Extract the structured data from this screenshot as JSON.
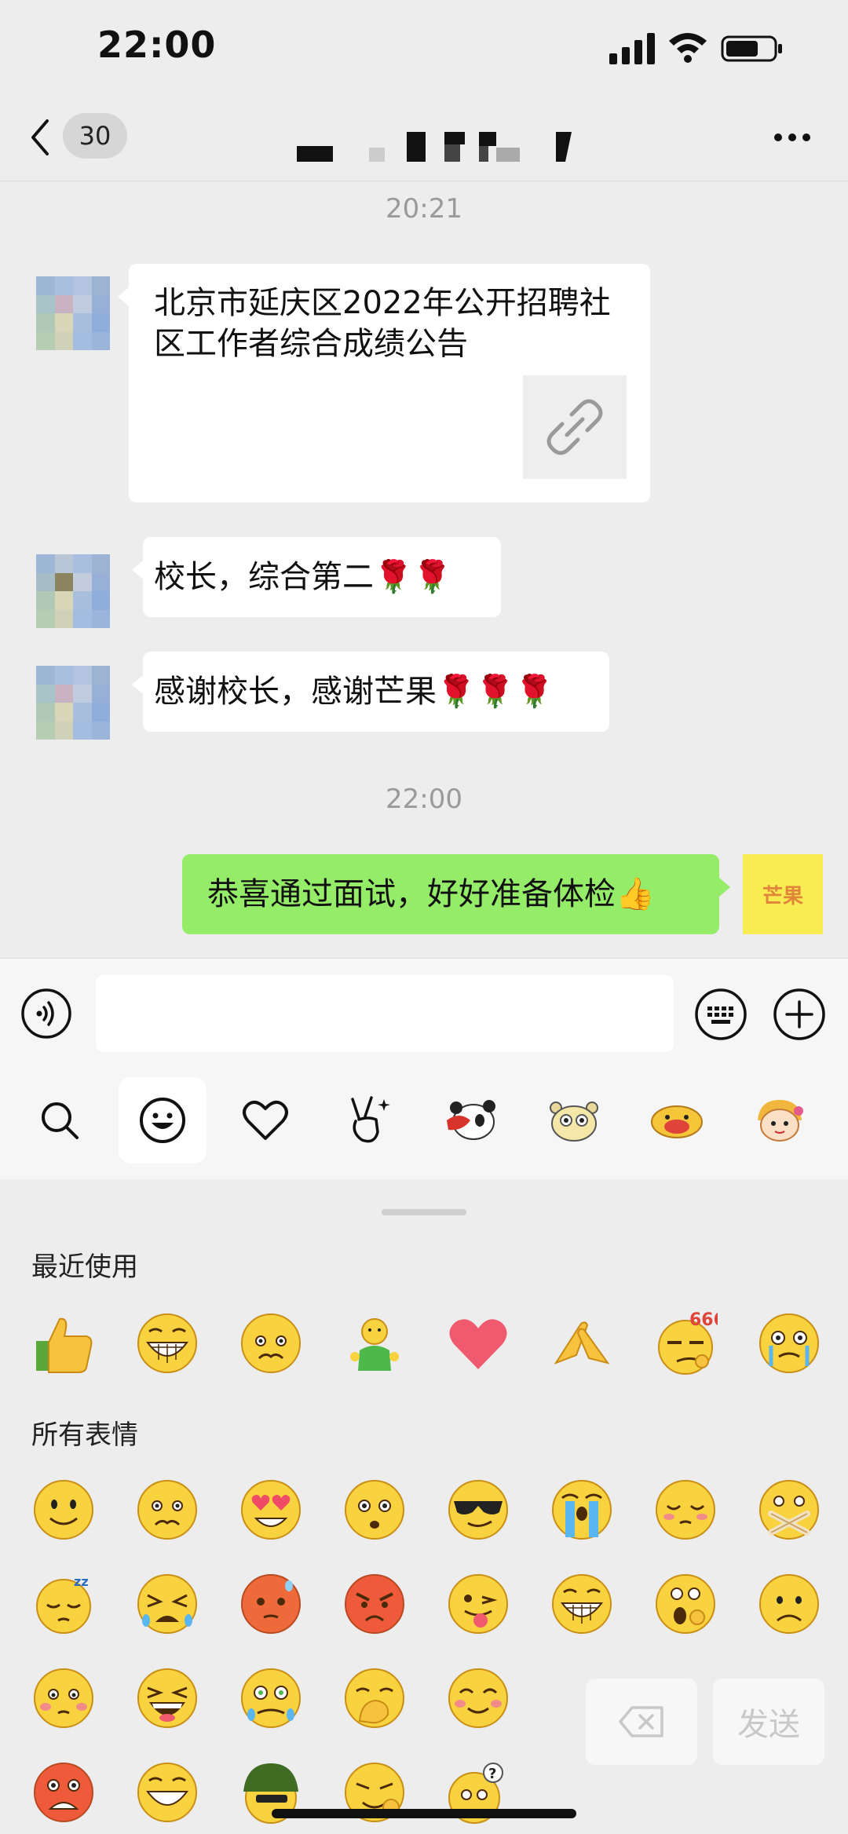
{
  "status_bar": {
    "time": "22:00"
  },
  "nav": {
    "unread_count": "30"
  },
  "chat": {
    "timestamp_1": "20:21",
    "link_message": {
      "text": "北京市延庆区2022年公开招聘社区工作者综合成绩公告"
    },
    "msg_2": "校长，综合第二🌹🌹",
    "msg_3": "感谢校长，感谢芒果🌹🌹🌹",
    "timestamp_2": "22:00",
    "msg_4": "恭喜通过面试，好好准备体检👍",
    "self_avatar_text": "芒果"
  },
  "emoji_panel": {
    "recent_label": "最近使用",
    "all_label": "所有表情",
    "recent": [
      "thumbs-up",
      "grin",
      "worried",
      "green-man",
      "heart",
      "handshake",
      "666-smirk",
      "teary"
    ],
    "rows": [
      [
        "smile",
        "worried",
        "heart-eyes",
        "surprised",
        "cool",
        "crying",
        "shy",
        "shush"
      ],
      [
        "sleepy",
        "sobbing",
        "red-face",
        "angry",
        "tongue-wink",
        "grin",
        "yawn",
        "frown"
      ],
      [
        "blush-sad",
        "laugh",
        "tear-sweat",
        "covering-mouth",
        "smile-blush"
      ],
      [
        "scared",
        "grin",
        "soldier",
        "sneer",
        "question"
      ]
    ],
    "send_label": "发送"
  },
  "colors": {
    "background": "#ededed",
    "self_bubble": "#95ec69",
    "other_bubble": "#ffffff",
    "timestamp": "#9a9a9a"
  }
}
